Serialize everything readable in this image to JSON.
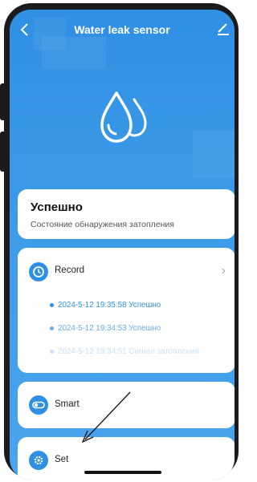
{
  "header": {
    "title": "Water leak sensor",
    "back_icon": "chevron-left-icon",
    "edit_icon": "pencil-icon"
  },
  "hero": {
    "icon": "water-drops-icon"
  },
  "status": {
    "title": "Успешно",
    "subtitle": "Состояние обнаружения затопления"
  },
  "record": {
    "label": "Record",
    "icon": "clock-icon",
    "chevron": "›",
    "entries": [
      "2024-5-12 19:35:58 Успешно",
      "2024-5-12 19:34:53 Успешно",
      "2024-5-12 19:34:51 Сигнал затопления"
    ]
  },
  "smart": {
    "label": "Smart",
    "icon": "toggle-icon"
  },
  "settings": {
    "label": "Set",
    "icon": "gear-icon"
  },
  "colors": {
    "accent": "#2f8fe3",
    "card": "#ffffff"
  }
}
